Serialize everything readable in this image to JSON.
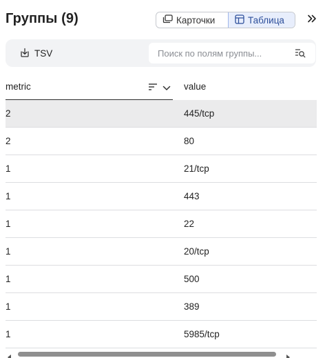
{
  "header": {
    "title": "Группы (9)",
    "view_switch": {
      "cards_label": "Карточки",
      "table_label": "Таблица",
      "selected": "Таблица"
    }
  },
  "toolbar": {
    "export_label": "TSV",
    "search": {
      "placeholder": "Поиск по полям группы...",
      "value": ""
    }
  },
  "table": {
    "columns": [
      {
        "key": "metric",
        "label": "metric"
      },
      {
        "key": "value",
        "label": "value"
      }
    ],
    "rows": [
      {
        "metric": "2",
        "value": "445/tcp",
        "selected": true
      },
      {
        "metric": "2",
        "value": "80"
      },
      {
        "metric": "1",
        "value": "21/tcp"
      },
      {
        "metric": "1",
        "value": "443"
      },
      {
        "metric": "1",
        "value": "22"
      },
      {
        "metric": "1",
        "value": "20/tcp"
      },
      {
        "metric": "1",
        "value": "500"
      },
      {
        "metric": "1",
        "value": "389"
      },
      {
        "metric": "1",
        "value": "5985/tcp"
      }
    ]
  },
  "icons": {
    "cards": "cards-icon",
    "table": "table-icon",
    "collapse": "double-chevron-right-icon",
    "export": "download-icon",
    "search": "search-list-icon",
    "sort": "sort-lines-icon",
    "column_menu": "chevron-down-icon"
  },
  "colors": {
    "accent": "#2d4f9a",
    "selected_tab_bg": "#e8eefc",
    "selected_row_bg": "#ebebec"
  }
}
